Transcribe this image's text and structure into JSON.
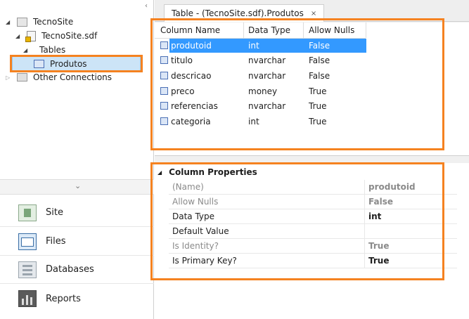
{
  "tree": {
    "root": "TecnoSite",
    "db": "TecnoSite.sdf",
    "tables": "Tables",
    "table_item": "Produtos",
    "other": "Other Connections"
  },
  "nav": [
    {
      "label": "Site"
    },
    {
      "label": "Files"
    },
    {
      "label": "Databases"
    },
    {
      "label": "Reports"
    }
  ],
  "tab": {
    "title": "Table - (TecnoSite.sdf).Produtos",
    "close": "×"
  },
  "grid": {
    "headers": [
      "Column Name",
      "Data Type",
      "Allow Nulls"
    ],
    "rows": [
      [
        "produtoid",
        "int",
        "False"
      ],
      [
        "titulo",
        "nvarchar",
        "False"
      ],
      [
        "descricao",
        "nvarchar",
        "False"
      ],
      [
        "preco",
        "money",
        "True"
      ],
      [
        "referencias",
        "nvarchar",
        "True"
      ],
      [
        "categoria",
        "int",
        "True"
      ]
    ],
    "selected_row": 0
  },
  "properties": {
    "group": "Column Properties",
    "rows": [
      {
        "name": "(Name)",
        "value": "produtoid",
        "disabled": true
      },
      {
        "name": "Allow Nulls",
        "value": "False",
        "disabled": true
      },
      {
        "name": "Data Type",
        "value": "int",
        "disabled": false
      },
      {
        "name": "Default Value",
        "value": "",
        "disabled": false
      },
      {
        "name": "Is Identity?",
        "value": "True",
        "disabled": true
      },
      {
        "name": "Is Primary Key?",
        "value": "True",
        "disabled": false
      }
    ]
  },
  "colors": {
    "highlight": "#f58220",
    "selection": "#3399ff",
    "disabled_text": "#8a8a8a"
  }
}
